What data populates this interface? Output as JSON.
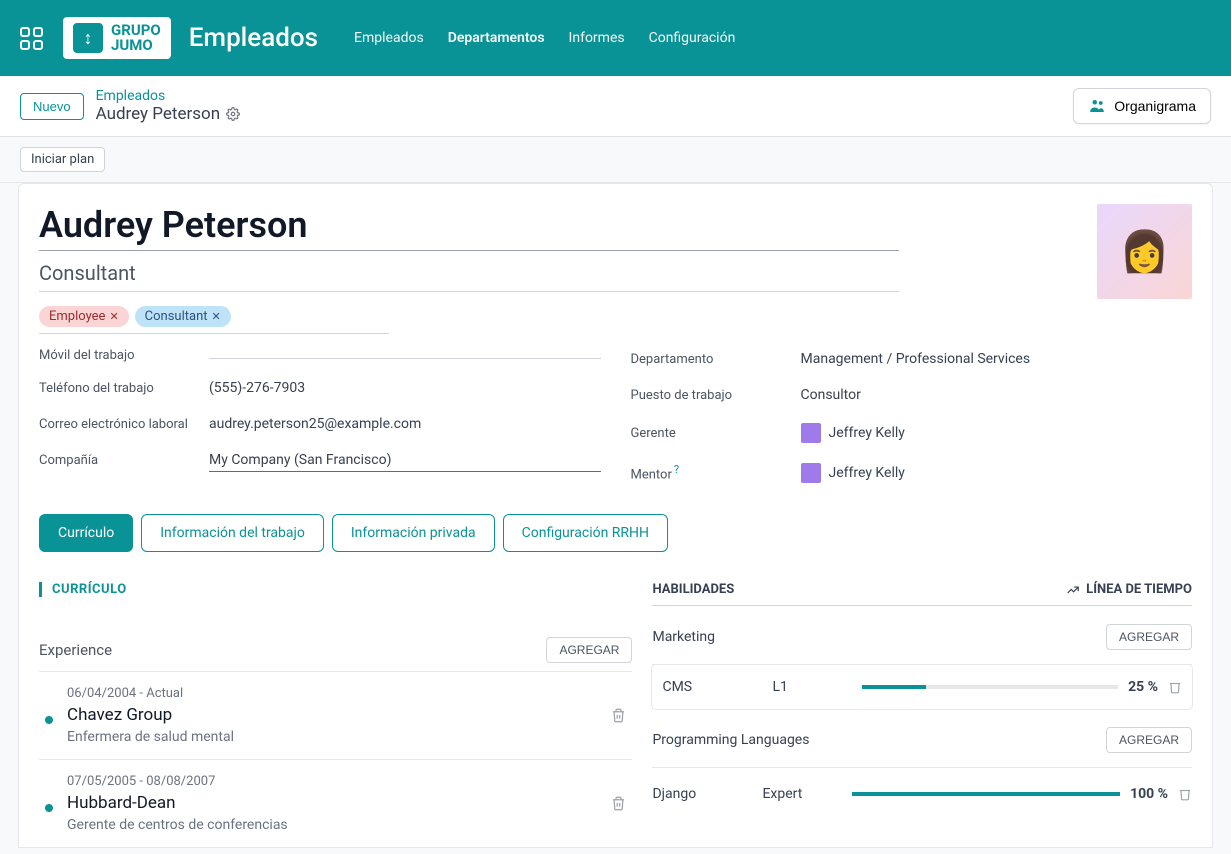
{
  "header": {
    "app_title": "Empleados",
    "logo_line1": "GRUPO",
    "logo_line2": "JUMO",
    "nav": [
      "Empleados",
      "Departamentos",
      "Informes",
      "Configuración"
    ],
    "active_nav": 1
  },
  "toolbar": {
    "new_button": "Nuevo",
    "breadcrumb_parent": "Empleados",
    "breadcrumb_current": "Audrey Peterson",
    "org_button": "Organigrama"
  },
  "status": {
    "start_plan": "Iniciar plan"
  },
  "employee": {
    "name": "Audrey Peterson",
    "role": "Consultant",
    "tags": [
      {
        "label": "Employee",
        "variant": "pink"
      },
      {
        "label": "Consultant",
        "variant": "blue"
      }
    ]
  },
  "left_fields": {
    "mobile_label": "Móvil del trabajo",
    "mobile_value": "",
    "phone_label": "Teléfono del trabajo",
    "phone_value": "(555)-276-7903",
    "email_label": "Correo electrónico laboral",
    "email_value": "audrey.peterson25@example.com",
    "company_label": "Compañía",
    "company_value": "My Company (San Francisco)"
  },
  "right_fields": {
    "dept_label": "Departamento",
    "dept_value": "Management / Professional Services",
    "job_label": "Puesto de trabajo",
    "job_value": "Consultor",
    "manager_label": "Gerente",
    "manager_value": "Jeffrey Kelly",
    "mentor_label": "Mentor",
    "mentor_value": "Jeffrey Kelly"
  },
  "tabs": [
    "Currículo",
    "Información del trabajo",
    "Información privada",
    "Configuración RRHH"
  ],
  "active_tab": 0,
  "resume": {
    "section_title": "CURRÍCULO",
    "experience_title": "Experience",
    "add_label": "AGREGAR",
    "items": [
      {
        "date": "06/04/2004 - Actual",
        "company": "Chavez Group",
        "role": "Enfermera de salud mental"
      },
      {
        "date": "07/05/2005 - 08/08/2007",
        "company": "Hubbard-Dean",
        "role": "Gerente de centros de conferencias"
      }
    ]
  },
  "skills": {
    "header_left": "HABILIDADES",
    "header_right": "LÍNEA DE TIEMPO",
    "add_label": "AGREGAR",
    "groups": [
      {
        "name": "Marketing",
        "type": "header"
      },
      {
        "name": "CMS",
        "level": "L1",
        "pct": "25 %",
        "pct_num": 25,
        "type": "skill"
      },
      {
        "name": "Programming Languages",
        "type": "header"
      },
      {
        "name": "Django",
        "level": "Expert",
        "pct": "100 %",
        "pct_num": 100,
        "type": "skill"
      }
    ]
  }
}
